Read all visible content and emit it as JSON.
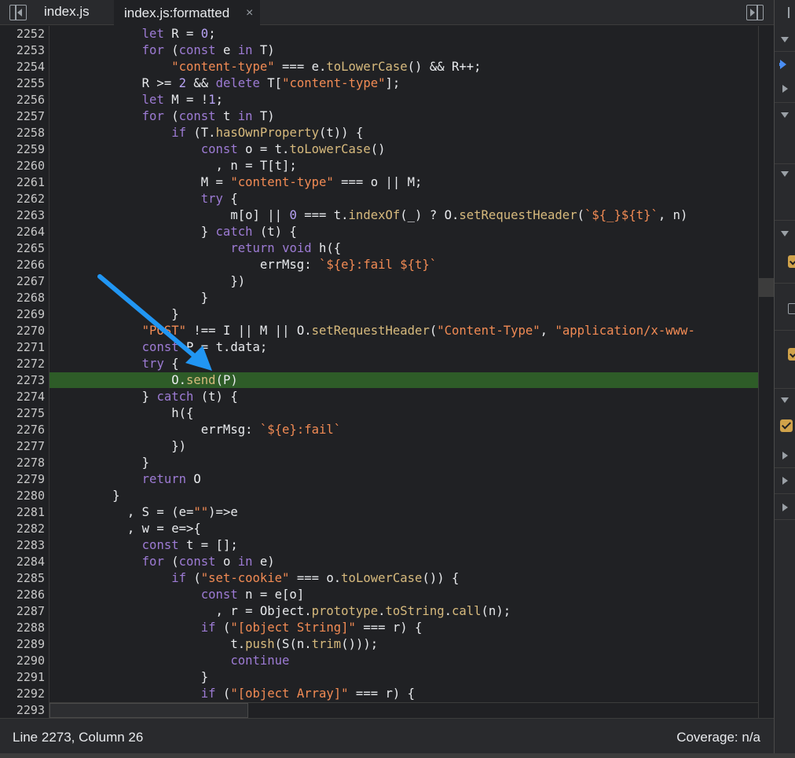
{
  "tabs": [
    {
      "label": "index.js"
    },
    {
      "label": "index.js:formatted",
      "close": "×"
    }
  ],
  "lines": [
    {
      "n": "2252",
      "html": "            <span class=\"kw\">let</span> R = <span class=\"num\">0</span>;"
    },
    {
      "n": "2253",
      "html": "            <span class=\"kw\">for</span> (<span class=\"kw\">const</span> e <span class=\"kw\">in</span> T)"
    },
    {
      "n": "2254",
      "html": "                <span class=\"str\">\"content-type\"</span> === e.<span class=\"fn\">toLowerCase</span>() && R++;"
    },
    {
      "n": "2255",
      "html": "            R >= <span class=\"num\">2</span> && <span class=\"kw\">delete</span> T[<span class=\"str\">\"content-type\"</span>];"
    },
    {
      "n": "2256",
      "html": "            <span class=\"kw\">let</span> M = !<span class=\"num\">1</span>;"
    },
    {
      "n": "2257",
      "html": "            <span class=\"kw\">for</span> (<span class=\"kw\">const</span> t <span class=\"kw\">in</span> T)"
    },
    {
      "n": "2258",
      "html": "                <span class=\"kw\">if</span> (T.<span class=\"fn\">hasOwnProperty</span>(t)) {"
    },
    {
      "n": "2259",
      "html": "                    <span class=\"kw\">const</span> o = t.<span class=\"fn\">toLowerCase</span>()"
    },
    {
      "n": "2260",
      "html": "                      , n = T[t];"
    },
    {
      "n": "2261",
      "html": "                    M = <span class=\"str\">\"content-type\"</span> === o || M;"
    },
    {
      "n": "2262",
      "html": "                    <span class=\"kw\">try</span> {"
    },
    {
      "n": "2263",
      "html": "                        m[o] || <span class=\"num\">0</span> === t.<span class=\"fn\">indexOf</span>(_) ? O.<span class=\"fn\">setRequestHeader</span>(<span class=\"str\">`${_}${t}`</span>, n)"
    },
    {
      "n": "2264",
      "html": "                    } <span class=\"kw\">catch</span> (t) {"
    },
    {
      "n": "2265",
      "html": "                        <span class=\"kw\">return</span> <span class=\"kw\">void</span> h({"
    },
    {
      "n": "2266",
      "html": "                            errMsg: <span class=\"str\">`${e}:fail ${t}`</span>"
    },
    {
      "n": "2267",
      "html": "                        })"
    },
    {
      "n": "2268",
      "html": "                    }"
    },
    {
      "n": "2269",
      "html": "                }"
    },
    {
      "n": "2270",
      "html": "            <span class=\"str\">\"POST\"</span> !== I || M || O.<span class=\"fn\">setRequestHeader</span>(<span class=\"str\">\"Content-Type\"</span>, <span class=\"str\">\"application/x-www-</span>"
    },
    {
      "n": "2271",
      "html": "            <span class=\"kw\">const</span> P = t.data;"
    },
    {
      "n": "2272",
      "html": "            <span class=\"kw\">try</span> {"
    },
    {
      "n": "2273",
      "html": "                O.<span class=\"fn\">send</span>(P)",
      "exec": true
    },
    {
      "n": "2274",
      "html": "            } <span class=\"kw\">catch</span> (t) {"
    },
    {
      "n": "2275",
      "html": "                h({"
    },
    {
      "n": "2276",
      "html": "                    errMsg: <span class=\"str\">`${e}:fail`</span>"
    },
    {
      "n": "2277",
      "html": "                })"
    },
    {
      "n": "2278",
      "html": "            }"
    },
    {
      "n": "2279",
      "html": "            <span class=\"kw\">return</span> O"
    },
    {
      "n": "2280",
      "html": "        }"
    },
    {
      "n": "2281",
      "html": "          , S = (e=<span class=\"str\">\"\"</span>)=>e"
    },
    {
      "n": "2282",
      "html": "          , w = e=>{"
    },
    {
      "n": "2283",
      "html": "            <span class=\"kw\">const</span> t = [];"
    },
    {
      "n": "2284",
      "html": "            <span class=\"kw\">for</span> (<span class=\"kw\">const</span> o <span class=\"kw\">in</span> e)"
    },
    {
      "n": "2285",
      "html": "                <span class=\"kw\">if</span> (<span class=\"str\">\"set-cookie\"</span> === o.<span class=\"fn\">toLowerCase</span>()) {"
    },
    {
      "n": "2286",
      "html": "                    <span class=\"kw\">const</span> n = e[o]"
    },
    {
      "n": "2287",
      "html": "                      , r = Object.<span class=\"fn\">prototype</span>.<span class=\"fn\">toString</span>.<span class=\"fn\">call</span>(n);"
    },
    {
      "n": "2288",
      "html": "                    <span class=\"kw\">if</span> (<span class=\"str\">\"[object String]\"</span> === r) {"
    },
    {
      "n": "2289",
      "html": "                        t.<span class=\"fn\">push</span>(S(n.<span class=\"fn\">trim</span>()));"
    },
    {
      "n": "2290",
      "html": "                        <span class=\"kw\">continue</span>"
    },
    {
      "n": "2291",
      "html": "                    }"
    },
    {
      "n": "2292",
      "html": "                    <span class=\"kw\">if</span> (<span class=\"str\">\"[object Array]\"</span> === r) {"
    },
    {
      "n": "2293",
      "html": ""
    }
  ],
  "status": {
    "position": "Line 2273, Column 26",
    "coverage": "Coverage: n/a"
  },
  "colors": {
    "background": "#202124",
    "exec_line": "#2e5c28",
    "arrow": "#2196f3",
    "keyword": "#9d7bd4",
    "string": "#f28b54",
    "function": "#d7ba7d",
    "checkbox": "#d0a24a"
  }
}
